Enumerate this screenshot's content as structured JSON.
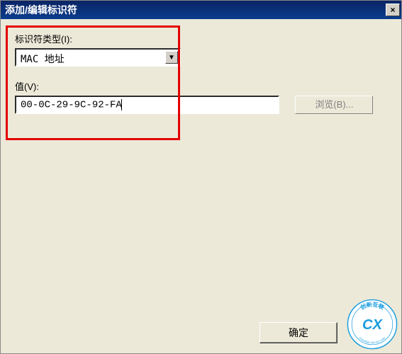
{
  "titlebar": {
    "title": "添加/编辑标识符",
    "close_label": "×"
  },
  "form": {
    "type_label": "标识符类型(I):",
    "type_selected": "MAC 地址",
    "value_label": "值(V):",
    "value_text": "00-0C-29-9C-92-FA",
    "browse_label": "浏览(B)..."
  },
  "buttons": {
    "ok_label": "确定"
  },
  "watermark": {
    "top_text": "创新互联",
    "bottom_text": "CHUANG XIN HU LIAN",
    "cx_text": "CX"
  }
}
